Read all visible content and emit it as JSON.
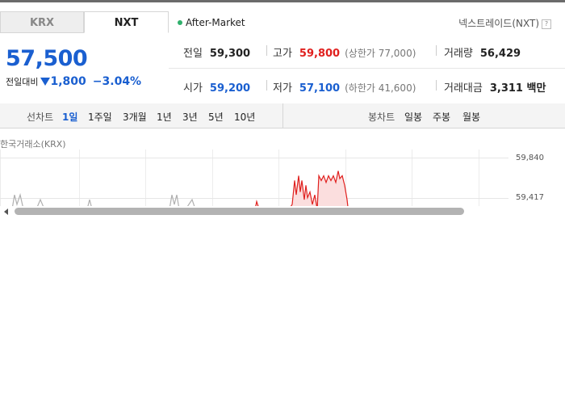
{
  "tabs": [
    {
      "label": "KRX",
      "active": false
    },
    {
      "label": "NXT",
      "active": true
    }
  ],
  "session": "After-Market",
  "exchange_name": "넥스트레이드(NXT)",
  "help_icon": "?",
  "price": "57,500",
  "change": {
    "label": "전일대비",
    "direction": "down",
    "amount": "1,800",
    "percent": "−3.04%"
  },
  "stats": {
    "prev_close": {
      "label": "전일",
      "value": "59,300"
    },
    "high": {
      "label": "고가",
      "value": "59,800",
      "sub": "(상한가 77,000)"
    },
    "volume": {
      "label": "거래량",
      "value": "56,429"
    },
    "open": {
      "label": "시가",
      "value": "59,200"
    },
    "low": {
      "label": "저가",
      "value": "57,100",
      "sub": "(하한가 41,600)"
    },
    "amount": {
      "label": "거래대금",
      "value": "3,311 백만"
    }
  },
  "toolbar": {
    "line_chart_label": "선차트",
    "line_periods": [
      "1일",
      "1주일",
      "3개월",
      "1년",
      "3년",
      "5년",
      "10년"
    ],
    "active_period": "1일",
    "candle_chart_label": "봉차트",
    "candle_periods": [
      "일봉",
      "주봉",
      "월봉"
    ]
  },
  "chart_data": {
    "type": "line",
    "source_label": "한국거래소(KRX)",
    "y_ticks": [
      "59,840",
      "59,417"
    ],
    "ylim": [
      59000,
      59900
    ],
    "grid": true,
    "series": [
      {
        "color": "#b0b0b0",
        "points": [
          [
            3,
            59300
          ],
          [
            8,
            59300
          ],
          [
            15,
            59300
          ],
          [
            18,
            59450
          ],
          [
            21,
            59350
          ],
          [
            25,
            59450
          ],
          [
            29,
            59300
          ],
          [
            35,
            59300
          ],
          [
            45,
            59300
          ],
          [
            50,
            59400
          ],
          [
            55,
            59300
          ],
          [
            75,
            59300
          ],
          [
            85,
            59300
          ],
          [
            95,
            59300
          ],
          [
            108,
            59300
          ],
          [
            111,
            59400
          ],
          [
            114,
            59300
          ],
          [
            130,
            59300
          ],
          [
            155,
            59300
          ],
          [
            175,
            59300
          ],
          [
            195,
            59300
          ],
          [
            210,
            59300
          ],
          [
            213,
            59450
          ],
          [
            216,
            59350
          ],
          [
            219,
            59450
          ],
          [
            222,
            59300
          ],
          [
            230,
            59300
          ],
          [
            238,
            59400
          ],
          [
            242,
            59300
          ],
          [
            250,
            59300
          ],
          [
            270,
            59300
          ],
          [
            290,
            59300
          ],
          [
            310,
            59300
          ]
        ]
      },
      {
        "color": "#e0201e",
        "points": [
          [
            316,
            59300
          ],
          [
            318,
            59380
          ],
          [
            321,
            59300
          ],
          [
            330,
            59300
          ],
          [
            340,
            59300
          ],
          [
            345,
            59300
          ],
          [
            350,
            59300
          ],
          [
            358,
            59300
          ],
          [
            362,
            59350
          ],
          [
            365,
            59600
          ],
          [
            367,
            59450
          ],
          [
            370,
            59650
          ],
          [
            372,
            59480
          ],
          [
            374,
            59600
          ],
          [
            377,
            59400
          ],
          [
            379,
            59550
          ],
          [
            381,
            59420
          ],
          [
            384,
            59480
          ],
          [
            387,
            59350
          ],
          [
            390,
            59450
          ],
          [
            393,
            59300
          ],
          [
            395,
            59650
          ],
          [
            398,
            59600
          ],
          [
            401,
            59650
          ],
          [
            404,
            59580
          ],
          [
            407,
            59650
          ],
          [
            410,
            59600
          ],
          [
            413,
            59650
          ],
          [
            416,
            59580
          ],
          [
            419,
            59700
          ],
          [
            421,
            59620
          ],
          [
            424,
            59650
          ],
          [
            427,
            59550
          ],
          [
            430,
            59400
          ],
          [
            432,
            59250
          ]
        ]
      }
    ]
  }
}
